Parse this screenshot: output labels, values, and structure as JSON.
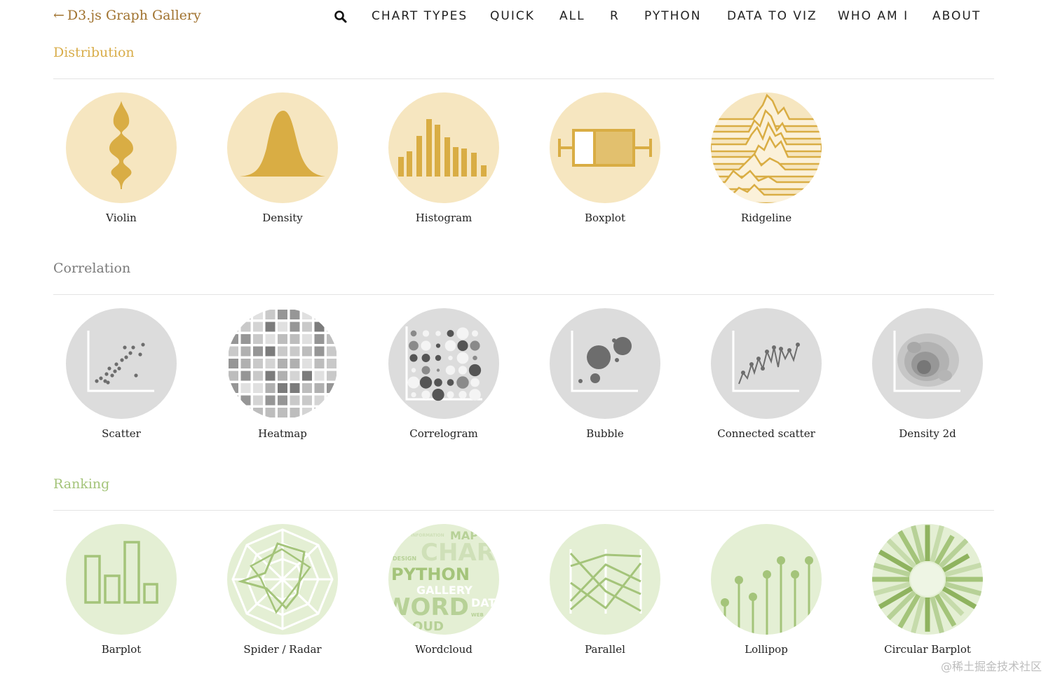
{
  "header": {
    "back_arrow": "←",
    "brand": "D3.js Graph Gallery",
    "nav": [
      "CHART TYPES",
      "QUICK",
      "ALL",
      "R",
      "PYTHON",
      "DATA TO VIZ",
      "WHO AM I",
      "ABOUT"
    ]
  },
  "sections": [
    {
      "title": "Distribution",
      "color": "#d8ad4a",
      "bg": "#f6e6c0",
      "items": [
        {
          "label": "Violin",
          "icon": "violin-icon"
        },
        {
          "label": "Density",
          "icon": "density-icon"
        },
        {
          "label": "Histogram",
          "icon": "histogram-icon"
        },
        {
          "label": "Boxplot",
          "icon": "boxplot-icon"
        },
        {
          "label": "Ridgeline",
          "icon": "ridgeline-icon"
        }
      ]
    },
    {
      "title": "Correlation",
      "color": "#7a7a7a",
      "bg": "#dcdcdc",
      "items": [
        {
          "label": "Scatter",
          "icon": "scatter-icon"
        },
        {
          "label": "Heatmap",
          "icon": "heatmap-icon"
        },
        {
          "label": "Correlogram",
          "icon": "correlogram-icon"
        },
        {
          "label": "Bubble",
          "icon": "bubble-icon"
        },
        {
          "label": "Connected scatter",
          "icon": "connected-scatter-icon"
        },
        {
          "label": "Density 2d",
          "icon": "density-2d-icon"
        }
      ]
    },
    {
      "title": "Ranking",
      "color": "#a4c47a",
      "bg": "#e4efd4",
      "items": [
        {
          "label": "Barplot",
          "icon": "barplot-icon"
        },
        {
          "label": "Spider / Radar",
          "icon": "spider-radar-icon"
        },
        {
          "label": "Wordcloud",
          "icon": "wordcloud-icon"
        },
        {
          "label": "Parallel",
          "icon": "parallel-icon"
        },
        {
          "label": "Lollipop",
          "icon": "lollipop-icon"
        },
        {
          "label": "Circular Barplot",
          "icon": "circular-barplot-icon"
        }
      ]
    }
  ],
  "wordcloud_words": [
    "MAP",
    "CHART",
    "PYTHON",
    "GALLERY",
    "WORD",
    "CLOUD",
    "DESIGN",
    "DATA",
    "WEB",
    "INFORMATION"
  ],
  "watermark": "@稀土掘金技术社区"
}
